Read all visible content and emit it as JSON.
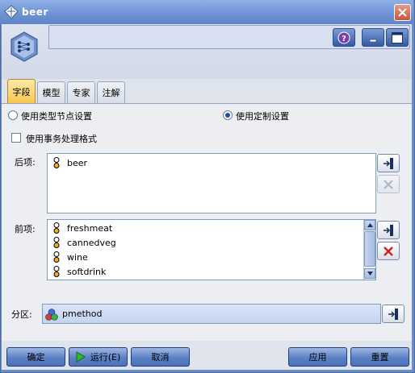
{
  "window": {
    "title": "beer"
  },
  "tabs": [
    {
      "label": "字段",
      "active": true
    },
    {
      "label": "模型",
      "active": false
    },
    {
      "label": "专家",
      "active": false
    },
    {
      "label": "注解",
      "active": false
    }
  ],
  "options": {
    "use_type_node": "使用类型节点设置",
    "use_custom": "使用定制设置",
    "selected": "use_custom",
    "use_transactional": "使用事务处理格式",
    "use_transactional_checked": false
  },
  "consequents": {
    "label": "后项:",
    "items": [
      "beer"
    ]
  },
  "antecedents": {
    "label": "前项:",
    "items": [
      "freshmeat",
      "cannedveg",
      "wine",
      "softdrink"
    ]
  },
  "partition": {
    "label": "分区:",
    "value": "pmethod"
  },
  "buttons": {
    "ok": "确定",
    "run": "运行(E)",
    "cancel": "取消",
    "apply": "应用",
    "reset": "重置"
  },
  "colors": {
    "title_bg": "#6d92d2",
    "active_tab": "#f6c64c",
    "button_bg": "#5d80c4",
    "remove_red": "#d02020"
  }
}
